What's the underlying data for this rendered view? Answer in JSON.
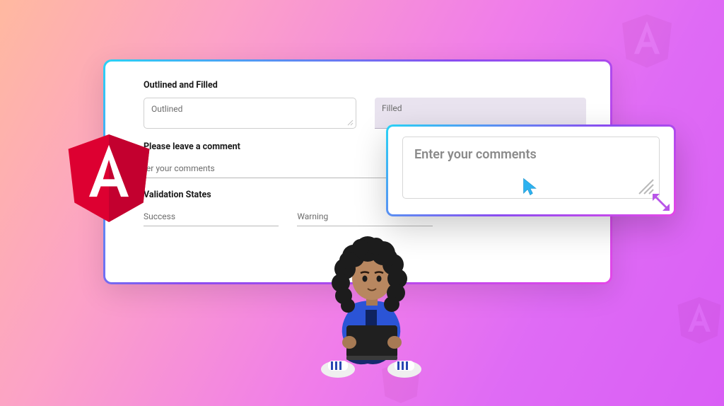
{
  "main": {
    "section1_title": "Outlined and Filled",
    "outlined_placeholder": "Outlined",
    "filled_placeholder": "Filled",
    "section2_title": "Please leave a comment",
    "comment_placeholder": "ter your comments",
    "section3_title": "Validation States",
    "state_success": "Success",
    "state_warning": "Warning"
  },
  "zoom": {
    "placeholder": "Enter your comments"
  }
}
